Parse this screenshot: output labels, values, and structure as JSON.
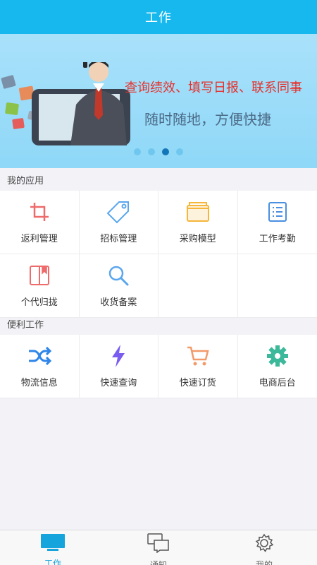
{
  "header": {
    "title": "工作"
  },
  "banner": {
    "line1": "查询绩效、填写日报、联系同事",
    "line2": "随时随地，方便快捷",
    "slides": 4,
    "active_slide": 3
  },
  "my_apps": {
    "label": "我的应用",
    "items": [
      {
        "label": "返利管理",
        "icon": "crop-icon",
        "color": "#ef6b6b"
      },
      {
        "label": "招标管理",
        "icon": "tag-icon",
        "color": "#5aa6ee"
      },
      {
        "label": "采购模型",
        "icon": "folder-icon",
        "color": "#f5b63a"
      },
      {
        "label": "工作考勤",
        "icon": "list-icon",
        "color": "#4a8fe0"
      },
      {
        "label": "个代归拢",
        "icon": "book-icon",
        "color": "#ef6b6b"
      },
      {
        "label": "收货备案",
        "icon": "search-icon",
        "color": "#5aa6ee"
      }
    ]
  },
  "convenient_work": {
    "label": "便利工作",
    "items": [
      {
        "label": "物流信息",
        "icon": "shuffle-icon",
        "color": "#2f86e8"
      },
      {
        "label": "快速查询",
        "icon": "lightning-icon",
        "color": "#7a5cf0"
      },
      {
        "label": "快速订货",
        "icon": "cart-icon",
        "color": "#f39a6b"
      },
      {
        "label": "电商后台",
        "icon": "gear-icon",
        "color": "#3cb89a"
      }
    ]
  },
  "tabbar": {
    "items": [
      {
        "label": "工作",
        "icon": "monitor-icon",
        "active": true
      },
      {
        "label": "通知",
        "icon": "chat-icon",
        "active": false
      },
      {
        "label": "我的",
        "icon": "settings-icon",
        "active": false
      }
    ],
    "active_color": "#16a4dc"
  }
}
